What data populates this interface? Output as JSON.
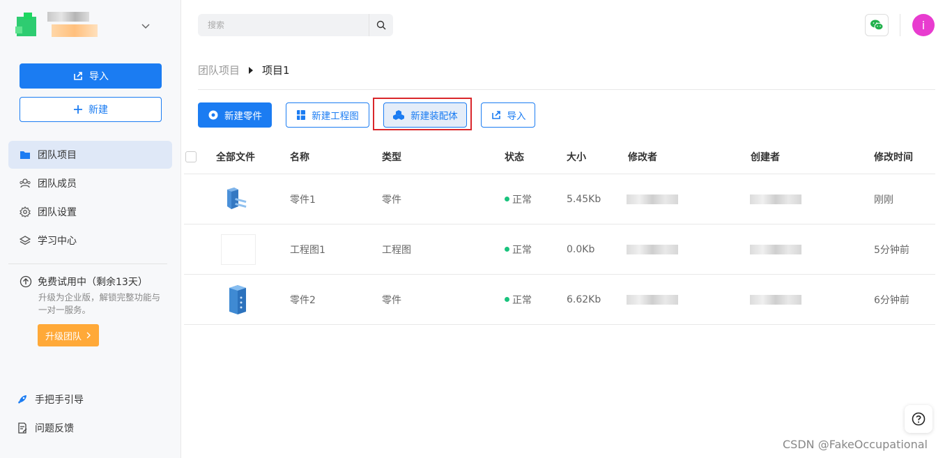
{
  "sidebar": {
    "import_label": "导入",
    "new_label": "新建",
    "nav": [
      {
        "label": "团队项目",
        "icon": "folder-icon",
        "active": true
      },
      {
        "label": "团队成员",
        "icon": "users-icon",
        "active": false
      },
      {
        "label": "团队设置",
        "icon": "gear-icon",
        "active": false
      },
      {
        "label": "学习中心",
        "icon": "layers-icon",
        "active": false
      }
    ],
    "trial": {
      "title": "免费试用中（剩余13天）",
      "desc": "升级为企业版，解锁完整功能与一对一服务。",
      "upgrade_label": "升级团队"
    },
    "guide_label": "手把手引导",
    "feedback_label": "问题反馈"
  },
  "header": {
    "search_placeholder": "搜索"
  },
  "user": {
    "avatar_letter": "i",
    "avatar_color": "#e83ccf"
  },
  "breadcrumb": {
    "parent": "团队项目",
    "current": "项目1"
  },
  "toolbar": {
    "new_part": "新建零件",
    "new_drawing": "新建工程图",
    "new_assembly": "新建装配体",
    "import": "导入"
  },
  "table": {
    "headers": {
      "all_files": "全部文件",
      "name": "名称",
      "type": "类型",
      "status": "状态",
      "size": "大小",
      "modifier": "修改者",
      "creator": "创建者",
      "modified_time": "修改时间"
    },
    "rows": [
      {
        "name": "零件1",
        "type": "零件",
        "status": "正常",
        "size": "5.45Kb",
        "modified": "刚刚",
        "thumb": "part-3d-icon"
      },
      {
        "name": "工程图1",
        "type": "工程图",
        "status": "正常",
        "size": "0.0Kb",
        "modified": "5分钟前",
        "thumb": "empty"
      },
      {
        "name": "零件2",
        "type": "零件",
        "status": "正常",
        "size": "6.62Kb",
        "modified": "6分钟前",
        "thumb": "part-3d-icon"
      }
    ]
  },
  "watermark": "CSDN @FakeOccupational",
  "colors": {
    "primary": "#1b7cf2",
    "warning": "#ffa938",
    "success": "#19c37d",
    "highlight": "#d9262a"
  }
}
